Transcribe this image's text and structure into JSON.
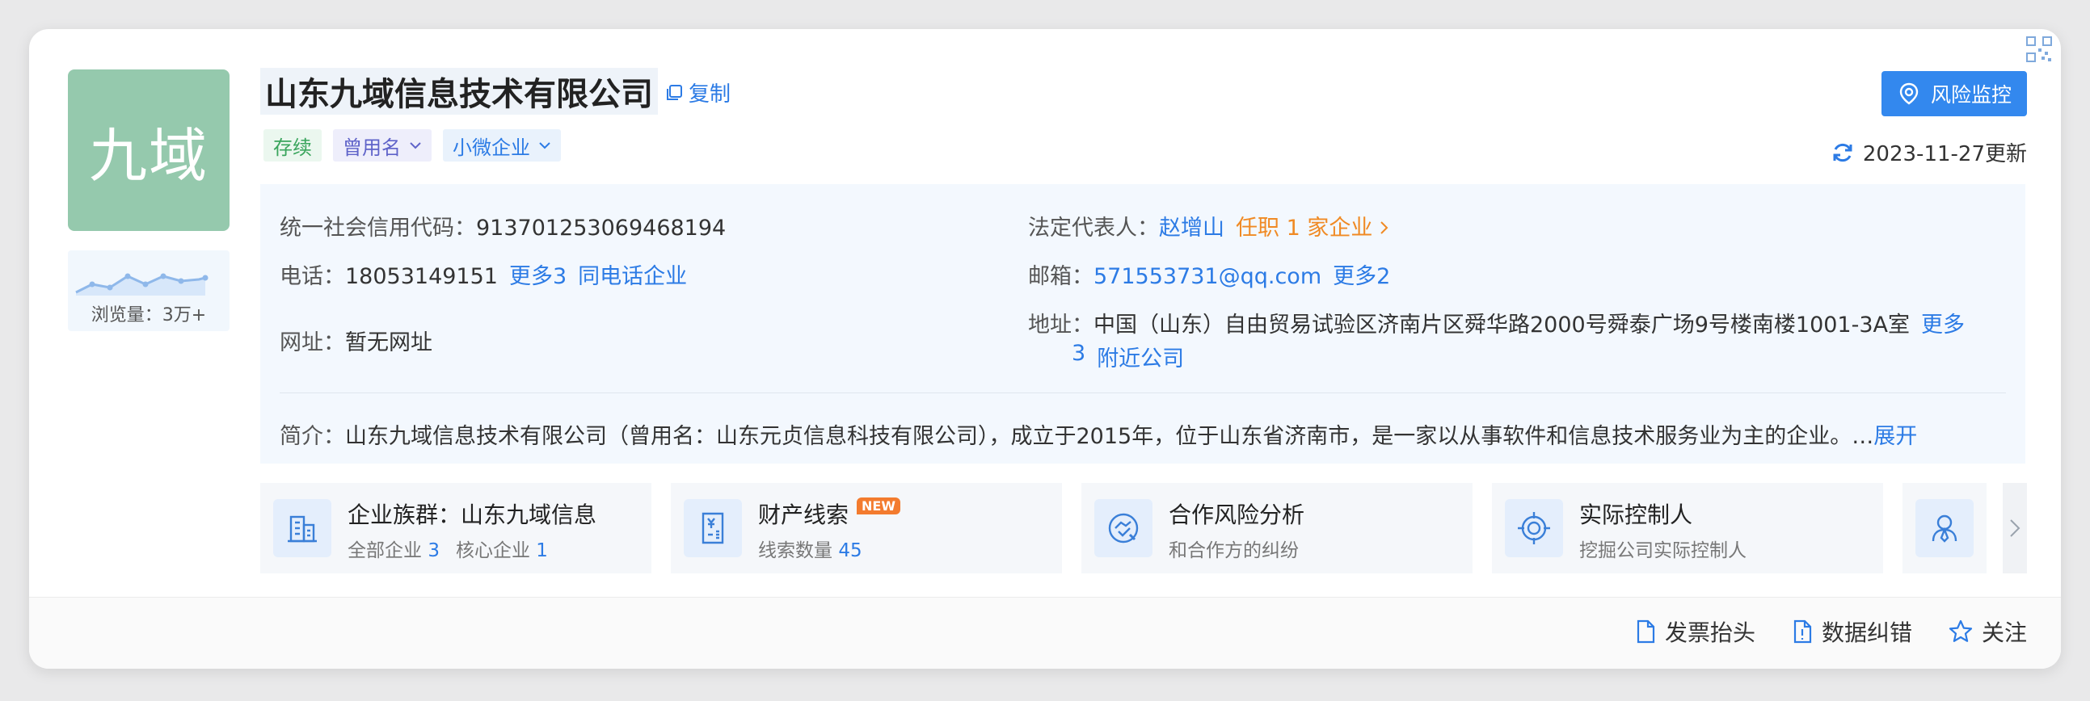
{
  "company": {
    "logo_text": "九域",
    "name": "山东九域信息技术有限公司",
    "copy_label": "复制",
    "views_label": "浏览量：3万+",
    "tags": [
      {
        "label": "存续",
        "style": "green",
        "dropdown": false
      },
      {
        "label": "曾用名",
        "style": "purple",
        "dropdown": true
      },
      {
        "label": "小微企业",
        "style": "blue",
        "dropdown": true
      }
    ]
  },
  "header": {
    "risk_button": "风险监控",
    "update_text": "2023-11-27更新"
  },
  "info": {
    "credit_code_label": "统一社会信用代码：",
    "credit_code": "913701253069468194",
    "legal_rep_label": "法定代表人：",
    "legal_rep": "赵增山",
    "legal_rep_jobs": "任职 1 家企业",
    "phone_label": "电话：",
    "phone": "18053149151",
    "phone_more": "更多3",
    "phone_same": "同电话企业",
    "email_label": "邮箱：",
    "email": "571553731@qq.com",
    "email_more": "更多2",
    "website_label": "网址：",
    "website": "暂无网址",
    "address_label": "地址：",
    "address": "中国（山东）自由贸易试验区济南片区舜华路2000号舜泰广场9号楼南楼1001-3A室",
    "address_more_1": "更多",
    "address_more_2": "3",
    "address_nearby": "附近公司",
    "intro_label": "简介：",
    "intro": "山东九域信息技术有限公司（曾用名：山东元贞信息科技有限公司），成立于2015年，位于山东省济南市，是一家以从事软件和信息技术服务业为主的企业。…",
    "intro_expand": "展开"
  },
  "tiles": [
    {
      "title": "企业族群：山东九域信息",
      "sub1_label": "全部企业",
      "sub1_value": "3",
      "sub2_label": "核心企业",
      "sub2_value": "1",
      "icon": "building-icon"
    },
    {
      "title": "财产线索",
      "badge": "NEW",
      "sub1_label": "线索数量",
      "sub1_value": "45",
      "icon": "property-doc-icon"
    },
    {
      "title": "合作风险分析",
      "sub_text": "和合作方的纠纷",
      "icon": "handshake-icon"
    },
    {
      "title": "实际控制人",
      "sub_text": "挖掘公司实际控制人",
      "icon": "target-icon"
    }
  ],
  "footer": {
    "invoice": "发票抬头",
    "correction": "数据纠错",
    "follow": "关注"
  },
  "colors": {
    "accent": "#2c7be5",
    "button": "#3388ee",
    "logo_bg": "#95c9ad",
    "orange": "#f08a24"
  }
}
